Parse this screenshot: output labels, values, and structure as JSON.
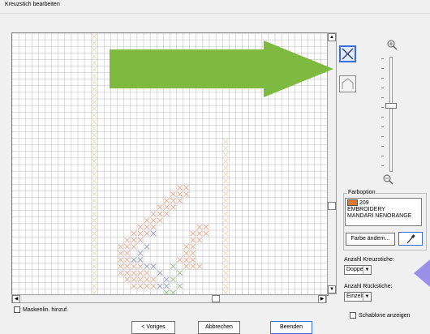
{
  "window": {
    "title": "Kreuzstich bearbeiten"
  },
  "color_option": {
    "legend": "Farboption",
    "swatch_color": "#e0782a",
    "code": "209",
    "line1": "EMBROIDERY",
    "line2": "MANDARI NENORANGE",
    "change_color_label": "Farbe ändern...",
    "eyedropper_icon": "eyedropper-icon"
  },
  "cross_count": {
    "label": "Anzahl Kreuzstiche:",
    "value": "Doppelt"
  },
  "back_count": {
    "label": "Anzahl Rückstiche:",
    "value": "Einzeln"
  },
  "show_template": {
    "label": "Schablone anzeigen"
  },
  "mask_line": {
    "label": "Maskenlin. hinzuf."
  },
  "buttons": {
    "prev": "< Voriges",
    "cancel": "Abbrechen",
    "finish": "Beenden"
  },
  "tools": {
    "cross": "cross-stitch-tool-icon",
    "back": "backstitch-tool-icon"
  },
  "zoom": {
    "in_icon": "zoom-in-icon",
    "out_icon": "zoom-out-icon",
    "level": 0.42
  },
  "colors": {
    "callout_arrow": "#7dba3f",
    "side_arrow": "#9b8fe8",
    "grid_line": "#b8b8b8",
    "stitch_orange": "#e8a98c",
    "stitch_green": "#8cc07a",
    "stitch_blue": "#8e9bc8",
    "stitch_cream": "#e8d8b8"
  }
}
